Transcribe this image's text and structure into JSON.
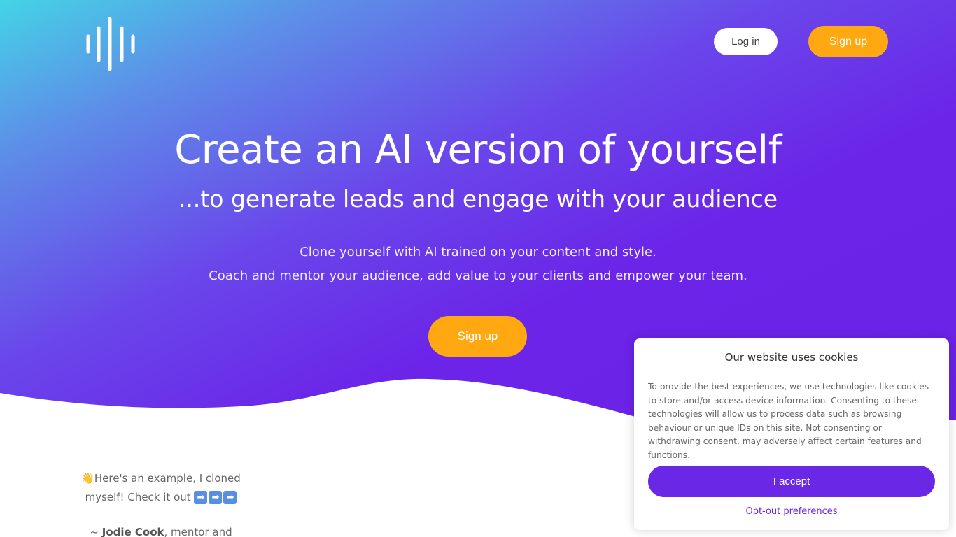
{
  "header": {
    "login_label": "Log in",
    "signup_label": "Sign up"
  },
  "hero": {
    "headline": "Create an AI version of yourself",
    "subheadline": "...to generate leads and engage with your audience",
    "description_line1": "Clone yourself with AI trained on your content and style.",
    "description_line2": "Coach and mentor your audience, add value to your clients and empower your team.",
    "cta_label": "Sign up"
  },
  "example": {
    "emoji": "👋",
    "text": "Here's an example, I cloned myself! Check it out",
    "arrow": "➡",
    "attribution_prefix": "~ ",
    "attribution_name": "Jodie Cook",
    "attribution_suffix": ", mentor and"
  },
  "cookie_banner": {
    "title": "Our website uses cookies",
    "body": "To provide the best experiences, we use technologies like cookies to store and/or access device information. Consenting to these technologies will allow us to process data such as browsing behaviour or unique IDs on this site. Not consenting or withdrawing consent, may adversely affect certain features and functions.",
    "accept_label": "I accept",
    "optout_label": "Opt-out preferences"
  },
  "colors": {
    "accent_orange": "#ffa812",
    "brand_purple": "#6a27e6",
    "gradient_start": "#44d4e6",
    "gradient_end": "#6a22e6"
  },
  "icons": {
    "logo": "soundwave-logo-icon",
    "example_arrows": "right-arrow-emoji-icon"
  }
}
